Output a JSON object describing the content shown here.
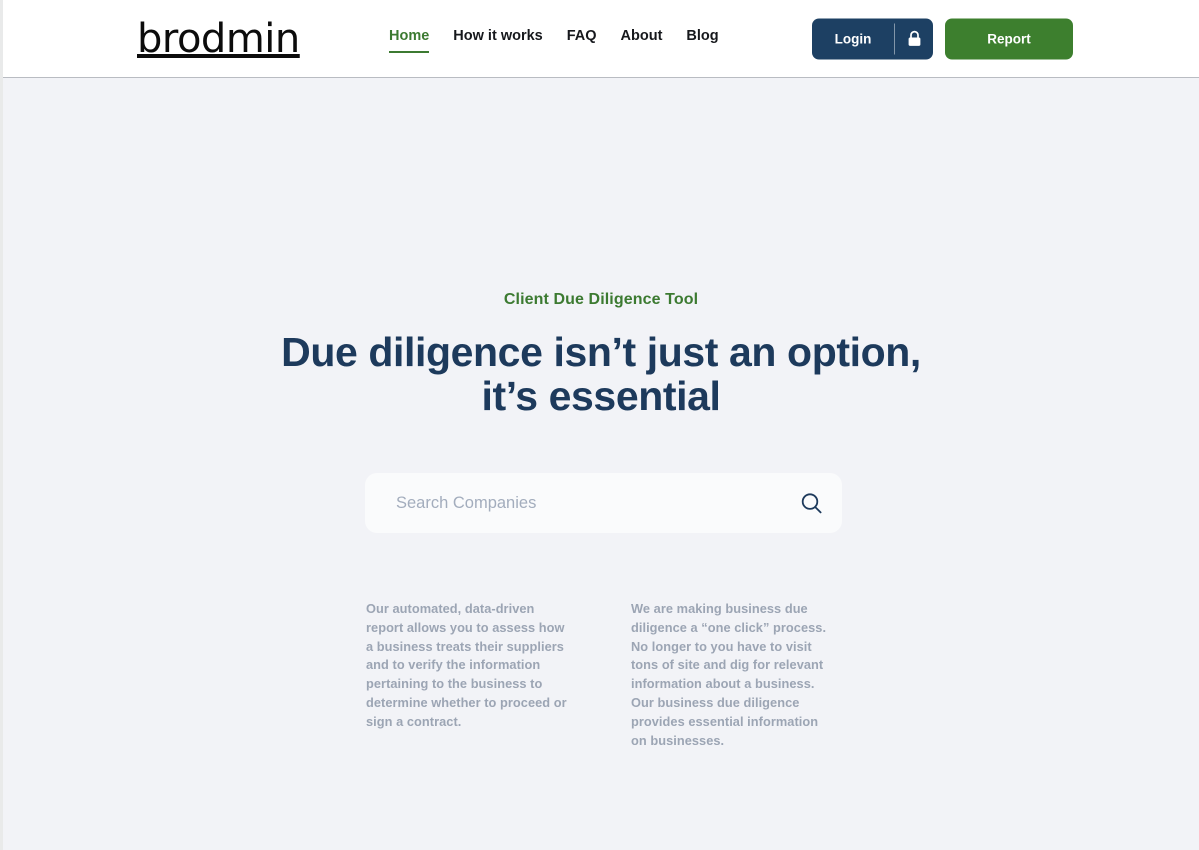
{
  "brand": {
    "logo_text": "brodmin",
    "accent_green": "#3c7a31",
    "navy": "#1d4063",
    "report_green": "#3d7f2e",
    "headline_navy": "#1d3a5c",
    "body_gray": "#9ca5b4",
    "page_background": "#f2f3f7"
  },
  "header": {
    "nav": [
      {
        "label": "Home",
        "active": true
      },
      {
        "label": "How it works",
        "active": false
      },
      {
        "label": "FAQ",
        "active": false
      },
      {
        "label": "About",
        "active": false
      },
      {
        "label": "Blog",
        "active": false
      }
    ],
    "login_label": "Login",
    "lock_icon": "lock-icon",
    "report_label": "Report"
  },
  "hero": {
    "eyebrow": "Client Due Diligence Tool",
    "headline": "Due diligence isn’t just an option, it’s essential",
    "search": {
      "value": "",
      "placeholder": "Search Companies",
      "icon": "search-icon"
    },
    "blurbs": [
      "Our automated, data-driven report allows you to assess how a business treats their suppliers and to verify the information pertaining to the business to determine whether to proceed or sign a contract.",
      "We are making business due diligence a “one click” process. No longer to you have to visit tons of site and dig for relevant information about a business. Our business due diligence provides essential information on businesses."
    ]
  }
}
